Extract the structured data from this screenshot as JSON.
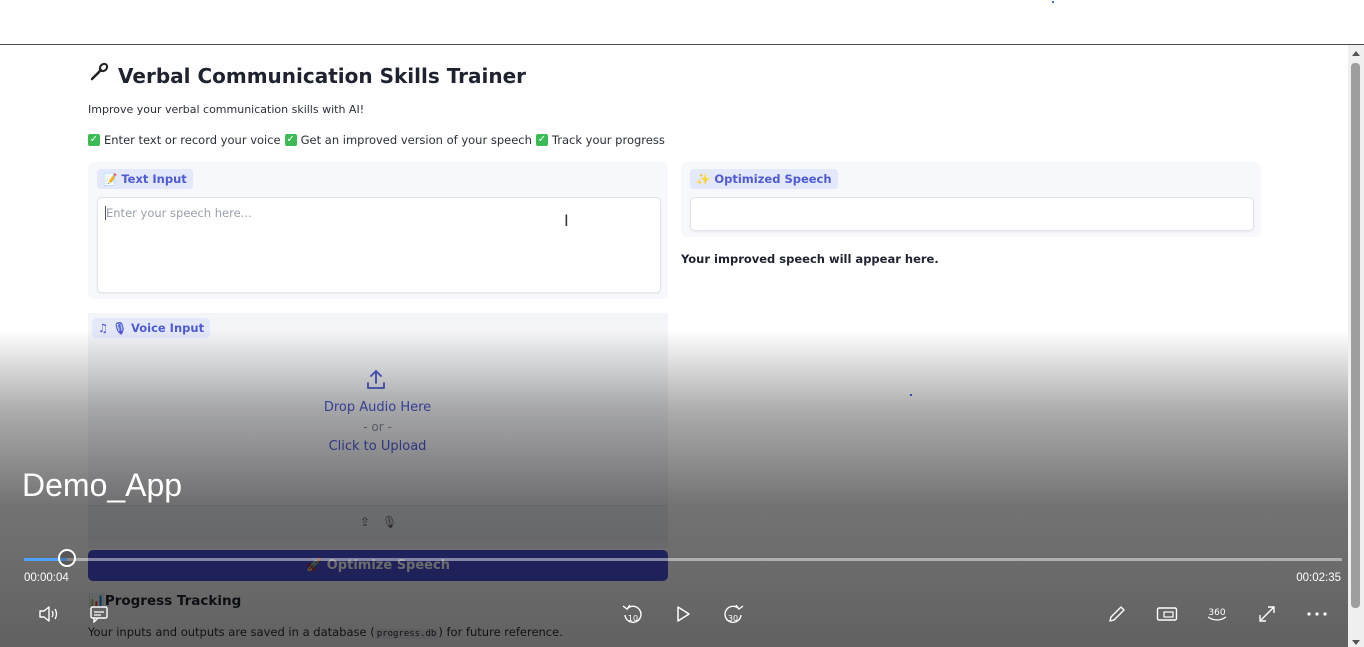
{
  "app": {
    "title": "Verbal Communication Skills Trainer",
    "title_icon": "🎤",
    "subtitle": "Improve your verbal communication skills with AI!",
    "features": [
      "Enter text or record your voice",
      "Get an improved version of your speech",
      "Track your progress"
    ],
    "text_input": {
      "label": "Text Input",
      "label_icon": "📝",
      "placeholder": "Enter your speech here..."
    },
    "optimized": {
      "label": "Optimized Speech",
      "label_icon": "✨",
      "placeholder_text": "Your improved speech will appear here."
    },
    "voice_input": {
      "label": "Voice Input",
      "label_icon": "🎙",
      "drop_text": "Drop Audio Here",
      "or_text": "- or -",
      "click_text": "Click to Upload"
    },
    "optimize_button": {
      "label": "Optimize Speech",
      "icon": "🚀"
    },
    "progress": {
      "title": "Progress Tracking",
      "icon": "📊",
      "text_before": "Your inputs and outputs are saved in a database (",
      "code": "progress.db",
      "text_after": ") for future reference."
    }
  },
  "player": {
    "video_title": "Demo_App",
    "current_time": "00:00:04",
    "total_time": "00:02:35",
    "progress_fraction": 0.033,
    "skip_back_seconds": "10",
    "skip_forward_seconds": "30",
    "accent_color": "#4fa3ff"
  }
}
